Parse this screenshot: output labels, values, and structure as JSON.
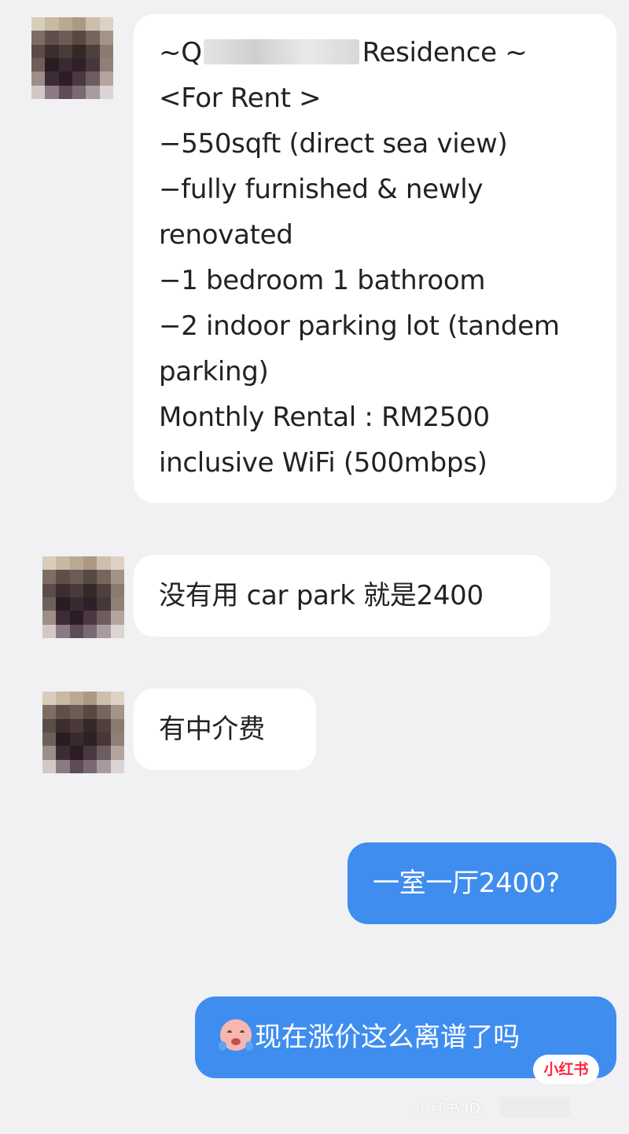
{
  "messages": [
    {
      "direction": "incoming",
      "lines": [
        {
          "before": "~Q",
          "after": "Residence ~"
        },
        "<For Rent >",
        "−550sqft (direct sea view)",
        "−fully furnished & newly",
        "renovated",
        "−1 bedroom 1 bathroom",
        "−2 indoor parking lot (tandem",
        "parking)",
        "Monthly Rental : RM2500",
        "inclusive WiFi (500mbps)"
      ]
    },
    {
      "direction": "incoming",
      "text": "没有用 car park 就是2400"
    },
    {
      "direction": "incoming",
      "text": "有中介费"
    },
    {
      "direction": "outgoing",
      "text": "一室一厅2400?"
    },
    {
      "direction": "outgoing",
      "emoji": "crying-face-icon",
      "text": "现在涨价这么离谱了吗"
    }
  ],
  "watermark": {
    "badge": "小红书",
    "id_label": "小红书 ID:"
  },
  "colors": {
    "background": "#f1f1f3",
    "incoming_bubble": "#ffffff",
    "outgoing_bubble": "#3f8def",
    "brand": "#ff2741"
  }
}
